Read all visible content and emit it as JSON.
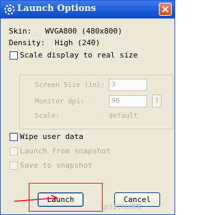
{
  "window": {
    "title": "Launch Options",
    "icon": "gear-icon",
    "close_icon": "close-icon"
  },
  "info": {
    "skin_label": "Skin:",
    "skin_value": "WVGA800 (480x800)",
    "density_label": "Density:",
    "density_value": "High (240)"
  },
  "options": {
    "scale_display": {
      "label": "Scale display to real size",
      "checked": false,
      "enabled": true
    },
    "screen_size": {
      "label": "Screen Size (in):",
      "value": "3",
      "enabled": false
    },
    "monitor_dpi": {
      "label": "Monitor dpi:",
      "value": "96",
      "help_label": "?",
      "enabled": false
    },
    "scale": {
      "label": "Scale:",
      "value": "default",
      "enabled": false
    },
    "wipe_user_data": {
      "label": "Wipe user data",
      "checked": false,
      "enabled": true
    },
    "launch_from_snapshot": {
      "label": "Launch from snapshot",
      "checked": false,
      "enabled": false
    },
    "save_to_snapshot": {
      "label": "Save to snapshot",
      "checked": false,
      "enabled": false
    }
  },
  "buttons": {
    "launch": "Launch",
    "cancel": "Cancel"
  },
  "watermark": "@51CTO博客",
  "colors": {
    "titlebar": "#1a5ad8",
    "dialog_bg": "#ece9d8",
    "annotation": "#dd1111"
  }
}
